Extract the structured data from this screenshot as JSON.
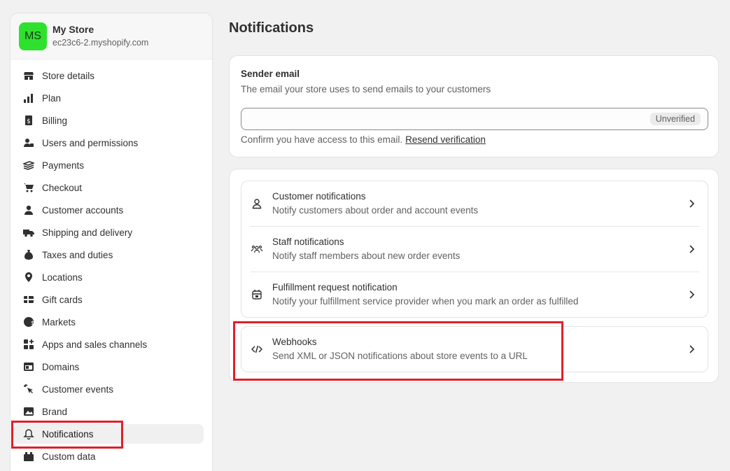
{
  "store": {
    "avatar_initials": "MS",
    "avatar_color": "#2fe12f",
    "name": "My Store",
    "domain": "ec23c6-2.myshopify.com"
  },
  "sidebar": {
    "items": [
      {
        "label": "Store details",
        "icon": "store-icon"
      },
      {
        "label": "Plan",
        "icon": "plan-icon"
      },
      {
        "label": "Billing",
        "icon": "billing-icon"
      },
      {
        "label": "Users and permissions",
        "icon": "users-icon"
      },
      {
        "label": "Payments",
        "icon": "payments-icon"
      },
      {
        "label": "Checkout",
        "icon": "cart-icon"
      },
      {
        "label": "Customer accounts",
        "icon": "person-icon"
      },
      {
        "label": "Shipping and delivery",
        "icon": "truck-icon"
      },
      {
        "label": "Taxes and duties",
        "icon": "tax-icon"
      },
      {
        "label": "Locations",
        "icon": "location-icon"
      },
      {
        "label": "Gift cards",
        "icon": "gift-card-icon"
      },
      {
        "label": "Markets",
        "icon": "globe-icon"
      },
      {
        "label": "Apps and sales channels",
        "icon": "apps-icon"
      },
      {
        "label": "Domains",
        "icon": "domains-icon"
      },
      {
        "label": "Customer events",
        "icon": "cursor-icon"
      },
      {
        "label": "Brand",
        "icon": "brand-icon"
      },
      {
        "label": "Notifications",
        "icon": "bell-icon"
      },
      {
        "label": "Custom data",
        "icon": "custom-data-icon"
      }
    ],
    "active_label": "Notifications"
  },
  "page": {
    "title": "Notifications"
  },
  "sender": {
    "title": "Sender email",
    "description": "The email your store uses to send emails to your customers",
    "status_badge": "Unverified",
    "confirm_text": "Confirm you have access to this email.",
    "resend_link": "Resend verification"
  },
  "notifications": {
    "items": [
      {
        "title": "Customer notifications",
        "description": "Notify customers about order and account events",
        "icon": "person-icon"
      },
      {
        "title": "Staff notifications",
        "description": "Notify staff members about new order events",
        "icon": "staff-icon"
      },
      {
        "title": "Fulfillment request notification",
        "description": "Notify your fulfillment service provider when you mark an order as fulfilled",
        "icon": "fulfillment-icon"
      }
    ],
    "webhooks": {
      "title": "Webhooks",
      "description": "Send XML or JSON notifications about store events to a URL",
      "icon": "code-icon"
    }
  },
  "colors": {
    "highlight": "#e0202a",
    "avatar": "#2fe12f"
  }
}
